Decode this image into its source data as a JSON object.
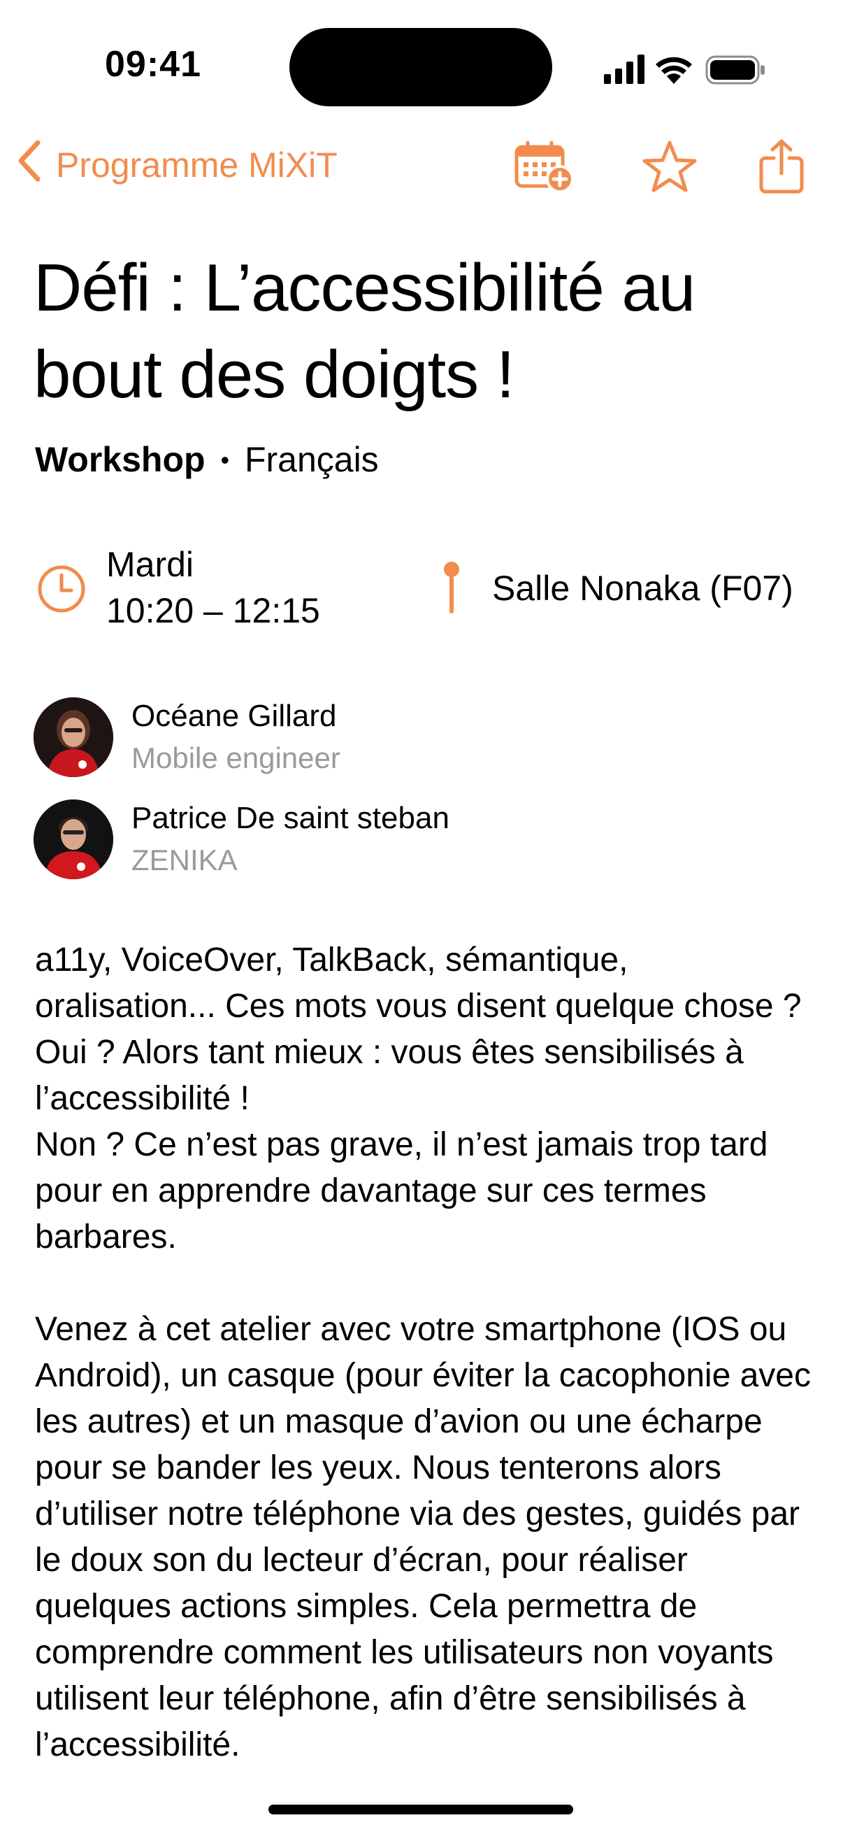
{
  "status_bar": {
    "time": "09:41"
  },
  "nav": {
    "back_label": "Programme MiXiT",
    "accent_color": "#F28C4E"
  },
  "session": {
    "title": "Défi : L’accessibilité au bout des doigts !",
    "kind": "Workshop",
    "separator": "•",
    "language": "Français",
    "day": "Mardi",
    "time_range": "10:20 – 12:15",
    "room": "Salle Nonaka (F07)"
  },
  "speakers": [
    {
      "name": "Océane Gillard",
      "subtitle": "Mobile engineer"
    },
    {
      "name": "Patrice De saint steban",
      "subtitle": "ZENIKA"
    }
  ],
  "description": "a11y, VoiceOver, TalkBack, sémantique, oralisation... Ces mots vous disent quelque chose ?\nOui ? Alors tant mieux : vous êtes sensibilisés à l’accessibilité !\nNon ? Ce n’est pas grave, il n’est jamais trop tard pour en apprendre davantage sur ces termes barbares.\n\nVenez à cet atelier avec votre smartphone (IOS ou Android), un casque (pour éviter la cacophonie avec les autres) et un masque d’avion ou une écharpe pour se bander les yeux. Nous tenterons alors d’utiliser notre téléphone via des gestes, guidés par le doux son du lecteur d’écran, pour réaliser quelques actions simples. Cela permettra de comprendre comment les utilisateurs non voyants utilisent leur téléphone, afin d’être sensibilisés à l’accessibilité."
}
